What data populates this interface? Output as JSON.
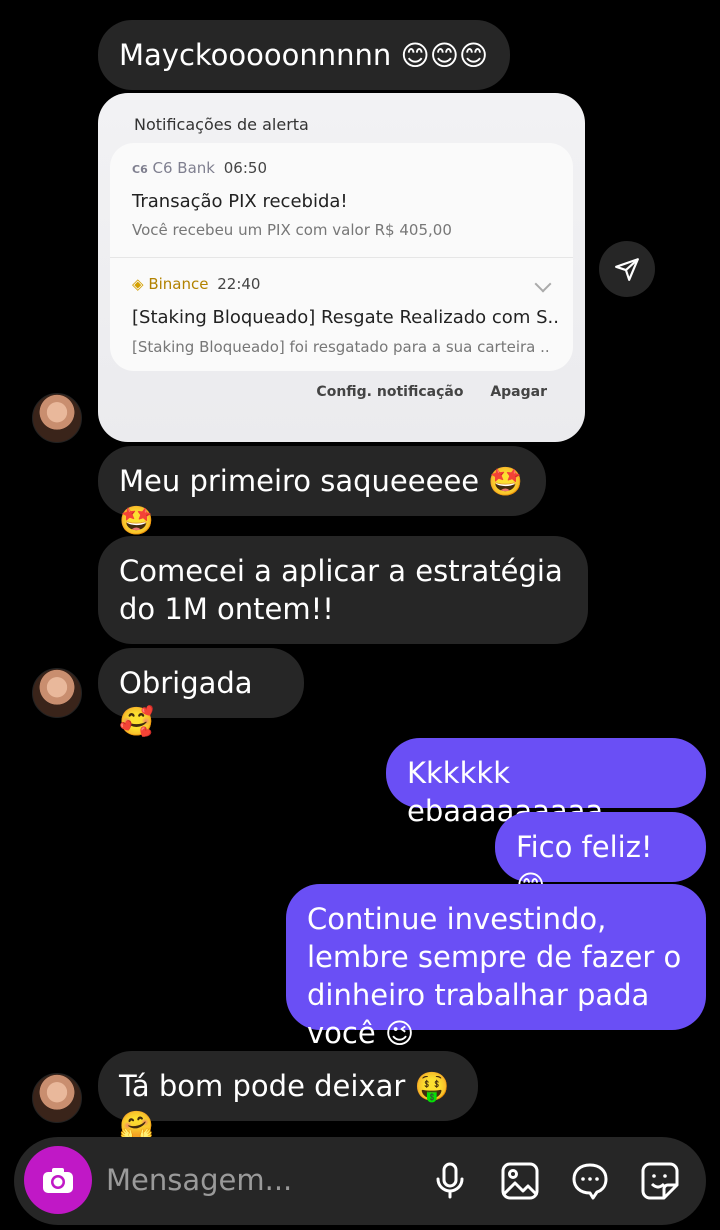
{
  "messages": [
    {
      "text": "Mayckooooonnnnn",
      "emoji": "😊😊😊"
    },
    {
      "text": "Meu primeiro saqueeeee",
      "emoji": "🤩🤩"
    },
    {
      "text": "Comecei a aplicar a estratégia do 1M ontem!!",
      "emoji": ""
    },
    {
      "text": "Obrigada",
      "emoji": "🥰"
    },
    {
      "text": "Kkkkkk ebaaaaaaaaa",
      "emoji": ""
    },
    {
      "text": "Fico feliz!",
      "emoji": "😊"
    },
    {
      "text": "Continue investindo, lembre sempre de fazer o dinheiro trabalhar pada você",
      "emoji": "😉"
    },
    {
      "text": "Tá bom pode deixar",
      "emoji": "🤑🤗"
    }
  ],
  "notification_card": {
    "title": "Notificações de alerta",
    "items": [
      {
        "app_badge": "C6",
        "app": "C6 Bank",
        "time": "06:50",
        "title": "Transação PIX recebida!",
        "body": "Você recebeu um PIX com valor R$ 405,00"
      },
      {
        "app_badge": "◈",
        "app": "Binance",
        "time": "22:40",
        "title": "[Staking Bloqueado] Resgate Realizado com S..",
        "body": "[Staking Bloqueado] foi resgatado para a sua carteira .."
      }
    ],
    "actions": {
      "settings": "Config. notificação",
      "clear": "Apagar"
    }
  },
  "composer": {
    "placeholder": "Mensagem...",
    "icons": [
      "camera-icon",
      "microphone-icon",
      "gallery-icon",
      "chat-bubble-icon",
      "sticker-icon"
    ]
  },
  "colors": {
    "background": "#000000",
    "received": "#262626",
    "sent": "#6a4ff5",
    "camera": "#c018c6"
  }
}
